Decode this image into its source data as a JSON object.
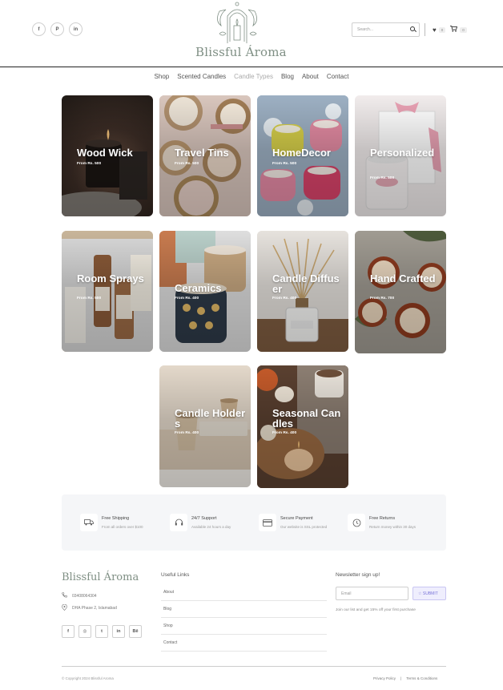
{
  "header": {
    "brand": "Blissful Ároma",
    "social": [
      {
        "icon": "facebook-icon",
        "glyph": "f"
      },
      {
        "icon": "pinterest-icon",
        "glyph": "P"
      },
      {
        "icon": "linkedin-icon",
        "glyph": "in"
      }
    ],
    "search_placeholder": "Search...",
    "wishlist_count": "0",
    "cart_count": "0"
  },
  "nav": [
    "Shop",
    "Scented Candles",
    "Candle Types",
    "Blog",
    "About",
    "Contact"
  ],
  "nav_active": "Candle Types",
  "categories": [
    {
      "name": "Wood Wick",
      "price": "From Rs. 500"
    },
    {
      "name": "Travel Tins",
      "price": "From Rs. 500"
    },
    {
      "name": "HomeDecor",
      "price": "From Rs. 500"
    },
    {
      "name": "Personalized",
      "price": "From Rs. 500"
    },
    {
      "name": "Room Sprays",
      "price": "From Rs. 500"
    },
    {
      "name": "Ceramics",
      "price": "From Rs. 400"
    },
    {
      "name": "Candle Diffuser",
      "price": "From Rs. 400"
    },
    {
      "name": "Hand Crafted",
      "price": "From Rs. 700"
    },
    {
      "name": "Candle Holders",
      "price": "From Rs. 400"
    },
    {
      "name": "Seasonal Candles",
      "price": "From Rs. 400"
    }
  ],
  "features": [
    {
      "icon": "truck-icon",
      "title": "Free Shipping",
      "sub": "From all orders over $100"
    },
    {
      "icon": "headset-icon",
      "title": "24/7 Support",
      "sub": "Available 24 hours a day"
    },
    {
      "icon": "credit-card-icon",
      "title": "Secure Payment",
      "sub": "Our website is SSL protected"
    },
    {
      "icon": "returns-icon",
      "title": "Free Returns",
      "sub": "Return money within 30 days"
    }
  ],
  "footer": {
    "brand": "Blissful Ároma",
    "phone": "03408064304",
    "address": "DHA Phase 2, Islamabad",
    "social": [
      {
        "icon": "facebook-icon",
        "glyph": "f"
      },
      {
        "icon": "instagram-icon",
        "glyph": "◎"
      },
      {
        "icon": "twitter-icon",
        "glyph": "t"
      },
      {
        "icon": "linkedin-icon",
        "glyph": "in"
      },
      {
        "icon": "behance-icon",
        "glyph": "Bē"
      }
    ],
    "links_heading": "Useful Links",
    "links": [
      "About",
      "Blog",
      "Shop",
      "Contact"
    ],
    "newsletter_heading": "Newsletter sign up!",
    "email_placeholder": "Email",
    "submit_label": "SUBMIT",
    "newsletter_note": "Join our list and get 15% off your first purchase",
    "copyright": "© Copyright 2024 Blissful Aroma",
    "privacy": "Privacy Policy",
    "separator": "|",
    "terms": "Terms & Conditions"
  },
  "colors": {
    "brand": "#7f8f84",
    "submit_accent": "#7b76d8",
    "feature_bg": "#f5f6f8"
  }
}
